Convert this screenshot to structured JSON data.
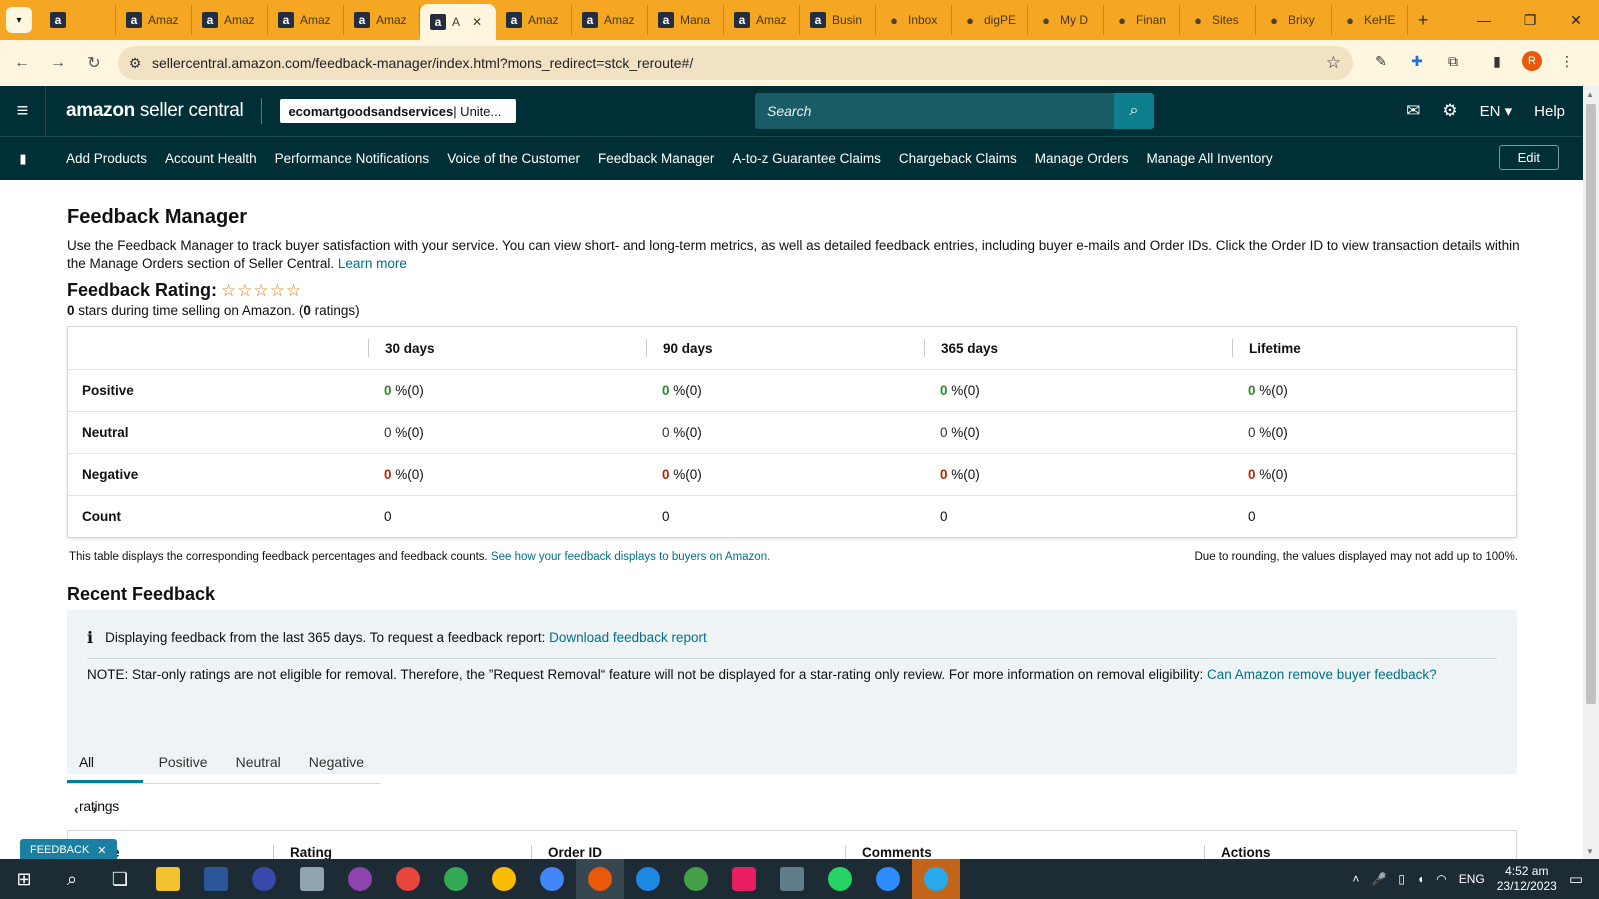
{
  "browser": {
    "tabs": [
      {
        "label": "",
        "icon": "amazon-a"
      },
      {
        "label": "Amaz",
        "icon": "amazon-a"
      },
      {
        "label": "Amaz",
        "icon": "amazon-a"
      },
      {
        "label": "Amaz",
        "icon": "amazon-a"
      },
      {
        "label": "Amaz",
        "icon": "amazon-a"
      },
      {
        "label": "A",
        "icon": "amazon-a",
        "active": true
      },
      {
        "label": "Amaz",
        "icon": "amazon-a"
      },
      {
        "label": "Amaz",
        "icon": "amazon-a"
      },
      {
        "label": "Mana",
        "icon": "amazon-a"
      },
      {
        "label": "Amaz",
        "icon": "amazon-a"
      },
      {
        "label": "Busin",
        "icon": "amazon-a"
      },
      {
        "label": "Inbox",
        "icon": "gmail-icon"
      },
      {
        "label": "digPE",
        "icon": "paw-icon"
      },
      {
        "label": "My D",
        "icon": "drive-icon"
      },
      {
        "label": "Finan",
        "icon": "sheets-icon"
      },
      {
        "label": "Sites",
        "icon": "sites-icon"
      },
      {
        "label": "Brixy",
        "icon": "globe-icon"
      },
      {
        "label": "KeHE",
        "icon": "globe-icon"
      }
    ],
    "url": "sellercentral.amazon.com/feedback-manager/index.html?mons_redirect=stck_reroute#/"
  },
  "header": {
    "logo_main": "amazon",
    "logo_sub": " seller central",
    "account_name": "ecomartgoodsandservices",
    "account_region": " | Unite...",
    "search_placeholder": "Search",
    "language": "EN",
    "help": "Help"
  },
  "bookmarks": [
    "Add Products",
    "Account Health",
    "Performance Notifications",
    "Voice of the Customer",
    "Feedback Manager",
    "A-to-z Guarantee Claims",
    "Chargeback Claims",
    "Manage Orders",
    "Manage All Inventory"
  ],
  "edit_label": "Edit",
  "page": {
    "title": "Feedback Manager",
    "description": "Use the Feedback Manager to track buyer satisfaction with your service. You can view short- and long-term metrics, as well as detailed feedback entries, including buyer e-mails and Order IDs. Click the Order ID to view transaction details within the Manage Orders section of Seller Central. ",
    "learn_more": "Learn more",
    "rating_title": "Feedback Rating:",
    "rating_stars": 0,
    "rating_stars_glyphs": "☆☆☆☆☆",
    "rating_value": "0",
    "rating_text": " stars during time selling on Amazon. (",
    "rating_count": "0",
    "rating_text_end": " ratings)"
  },
  "feedback_table": {
    "columns": [
      "30 days",
      "90 days",
      "365 days",
      "Lifetime"
    ],
    "rows": [
      {
        "label": "Positive",
        "type": "pos",
        "values": [
          [
            "0",
            " %(0)"
          ],
          [
            "0",
            " %(0)"
          ],
          [
            "0",
            " %(0)"
          ],
          [
            "0",
            " %(0)"
          ]
        ]
      },
      {
        "label": "Neutral",
        "type": "neu",
        "values": [
          [
            "0",
            " %(0)"
          ],
          [
            "0",
            " %(0)"
          ],
          [
            "0",
            " %(0)"
          ],
          [
            "0",
            " %(0)"
          ]
        ]
      },
      {
        "label": "Negative",
        "type": "neg",
        "values": [
          [
            "0",
            " %(0)"
          ],
          [
            "0",
            " %(0)"
          ],
          [
            "0",
            " %(0)"
          ],
          [
            "0",
            " %(0)"
          ]
        ]
      },
      {
        "label": "Count",
        "type": "count",
        "values": [
          [
            "0",
            ""
          ],
          [
            "0",
            ""
          ],
          [
            "0",
            ""
          ],
          [
            "0",
            ""
          ]
        ]
      }
    ],
    "note": "This table displays the corresponding feedback percentages and feedback counts. ",
    "note_link": "See how your feedback displays to buyers on Amazon.",
    "rounding_note": "Due to rounding, the values displayed may not add up to 100%."
  },
  "recent": {
    "title": "Recent Feedback",
    "info_text": "Displaying feedback from the last 365 days. To request a feedback report: ",
    "info_link": "Download feedback report",
    "note_text": "NOTE: Star-only ratings are not eligible for removal. Therefore, the ”Request Removal“ feature will not be displayed for a star-rating only review. For more information on removal eligibility: ",
    "note_link": "Can Amazon remove buyer feedback?",
    "tabs": [
      "All ratings",
      "Positive",
      "Neutral",
      "Negative"
    ],
    "columns": [
      "e",
      "Rating",
      "Order ID",
      "Comments",
      "Actions"
    ]
  },
  "feedback_button": "FEEDBACK",
  "taskbar": {
    "language": "ENG",
    "time": "4:52 am",
    "date": "23/12/2023"
  }
}
